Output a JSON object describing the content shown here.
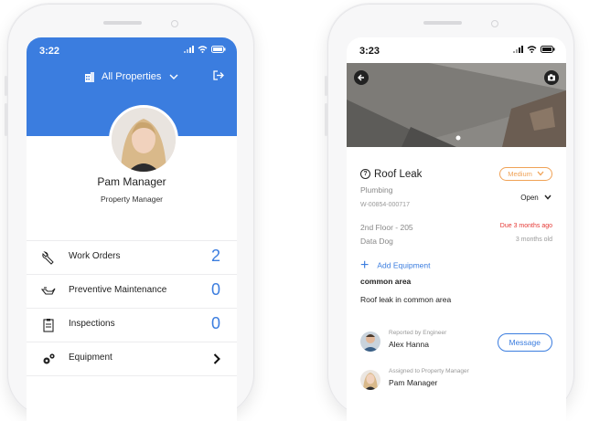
{
  "left_phone": {
    "status": {
      "time": "3:22"
    },
    "header": {
      "property_selector": "All Properties"
    },
    "profile": {
      "name": "Pam Manager",
      "role": "Property Manager"
    },
    "menu": [
      {
        "label": "Work Orders",
        "count": "2",
        "icon": "wrench-icon"
      },
      {
        "label": "Preventive Maintenance",
        "count": "0",
        "icon": "oil-can-icon"
      },
      {
        "label": "Inspections",
        "count": "0",
        "icon": "clipboard-icon"
      },
      {
        "label": "Equipment",
        "count": "",
        "icon": "gears-icon"
      }
    ]
  },
  "right_phone": {
    "status": {
      "time": "3:23"
    },
    "work_order": {
      "title": "Roof Leak",
      "priority": "Medium",
      "category": "Plumbing",
      "number": "W-00854-000717",
      "status": "Open",
      "location": "2nd Floor - 205",
      "due": "Due 3 months ago",
      "tenant": "Data Dog",
      "age": "3 months old",
      "add_equipment": "Add Equipment",
      "area": "common area",
      "description": "Roof leak in common area"
    },
    "reported": {
      "caption": "Reported by Engineer",
      "name": "Alex Hanna"
    },
    "assigned": {
      "caption": "Assigned to Property Manager",
      "name": "Pam Manager"
    },
    "message_button": "Message"
  },
  "colors": {
    "primary": "#3b7ddf",
    "priority": "#f0a256",
    "overdue": "#e53935"
  }
}
